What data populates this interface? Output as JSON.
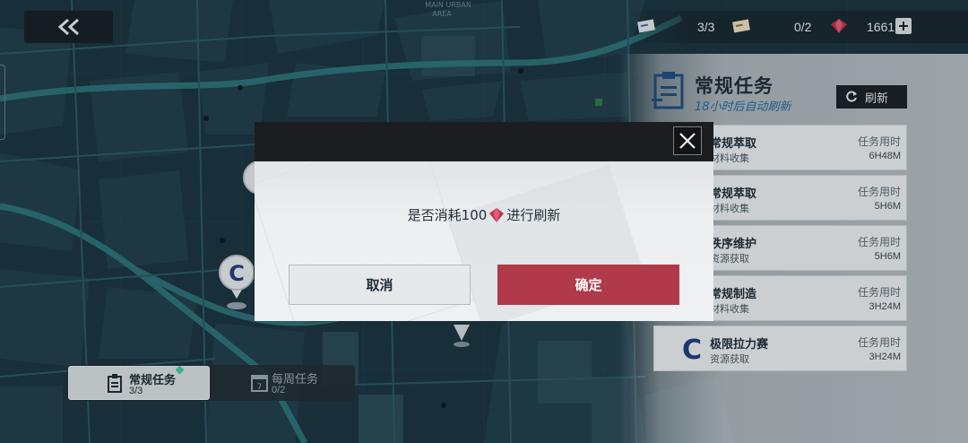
{
  "map": {
    "district_label_line1": "MAIN URBAN",
    "district_label_line2": "AREA"
  },
  "topbar": {
    "back_icon": "double-chevron-left-icon",
    "ticket_count": "3/3",
    "pass_count": "0/2",
    "gem_count": "1661",
    "plus_icon": "plus-icon",
    "gem_color": "#c0344a"
  },
  "panel": {
    "title": "常规任务",
    "subtitle": "18小时后自动刷新",
    "refresh_label": "刷新",
    "tasks": [
      {
        "name": "常规萃取",
        "sub": "材料收集",
        "time_label": "任务用时",
        "time": "6H48M"
      },
      {
        "name": "常规萃取",
        "sub": "材料收集",
        "time_label": "任务用时",
        "time": "5H6M"
      },
      {
        "name": "秩序维护",
        "sub": "资源获取",
        "time_label": "任务用时",
        "time": "5H6M"
      },
      {
        "name": "常规制造",
        "sub": "材料收集",
        "time_label": "任务用时",
        "time": "3H24M"
      },
      {
        "name": "极限拉力赛",
        "sub": "资源获取",
        "time_label": "任务用时",
        "time": "3H24M"
      }
    ]
  },
  "tabs": {
    "daily_label": "常规任务",
    "daily_count": "3/3",
    "weekly_label": "每周任务",
    "weekly_count": "0/2",
    "weekly_icon_text": "7"
  },
  "markers": {
    "c_marker_label": "C"
  },
  "dialog": {
    "message_prefix": "是否消耗100",
    "message_suffix": "进行刷新",
    "cancel_label": "取消",
    "confirm_label": "确定",
    "close_icon": "close-icon",
    "accent_color": "#b03a4a"
  }
}
